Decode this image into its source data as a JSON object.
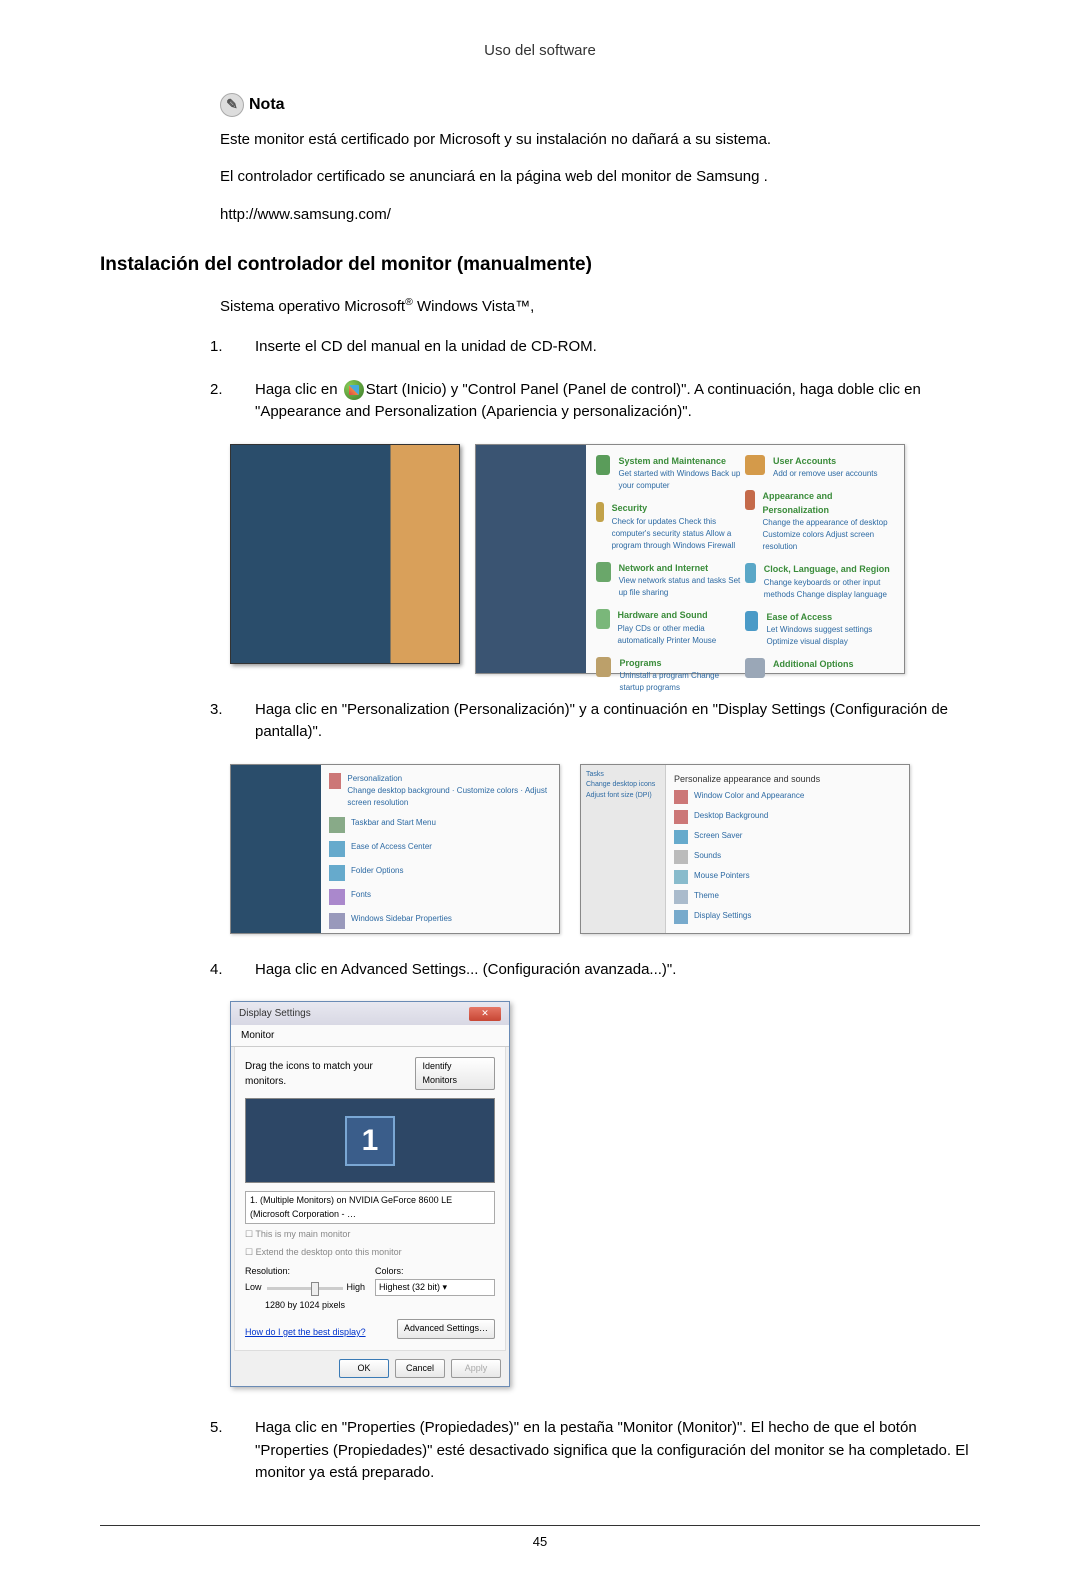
{
  "header": "Uso del software",
  "note": {
    "title": "Nota",
    "lines": [
      "Este monitor está certificado por Microsoft y su instalación no dañará a su sistema.",
      "El controlador certificado se anunciará en la página web del monitor de Samsung .",
      "http://www.samsung.com/"
    ]
  },
  "section_heading": "Instalación del controlador del monitor (manualmente)",
  "os_text_pre": "Sistema operativo Microsoft",
  "os_text_mid": " Windows Vista",
  "os_text_post": ",",
  "steps": {
    "s1": {
      "num": "1.",
      "text": "Inserte el CD del manual en la unidad de CD-ROM."
    },
    "s2": {
      "num": "2.",
      "pre": "Haga clic en ",
      "mid": "Start (Inicio) y \"Control Panel (Panel de control)\". A continuación, haga doble clic en \"Appearance and Personalization (Apariencia y personalización)\"."
    },
    "s3": {
      "num": "3.",
      "text": "Haga clic en \"Personalization (Personalización)\" y a continuación en \"Display Settings (Configuración de pantalla)\"."
    },
    "s4": {
      "num": "4.",
      "text": "Haga clic en Advanced Settings... (Configuración avanzada...)\"."
    },
    "s5": {
      "num": "5.",
      "text": "Haga clic en \"Properties (Propiedades)\" en la pestaña \"Monitor (Monitor)\". El hecho de que el botón \"Properties (Propiedades)\" esté desactivado significa que la configuración del monitor se ha completado. El monitor ya está preparado."
    }
  },
  "control_panel": {
    "items_left": [
      {
        "title": "System and Maintenance",
        "sub": "Get started with Windows\nBack up your computer"
      },
      {
        "title": "Security",
        "sub": "Check for updates\nCheck this computer's security status\nAllow a program through Windows Firewall"
      },
      {
        "title": "Network and Internet",
        "sub": "View network status and tasks\nSet up file sharing"
      },
      {
        "title": "Hardware and Sound",
        "sub": "Play CDs or other media automatically\nPrinter\nMouse"
      },
      {
        "title": "Programs",
        "sub": "Uninstall a program\nChange startup programs"
      }
    ],
    "items_right": [
      {
        "title": "User Accounts",
        "sub": "Add or remove user accounts"
      },
      {
        "title": "Appearance and Personalization",
        "sub": "Change the appearance of desktop\nCustomize colors\nAdjust screen resolution"
      },
      {
        "title": "Clock, Language, and Region",
        "sub": "Change keyboards or other input methods\nChange display language"
      },
      {
        "title": "Ease of Access",
        "sub": "Let Windows suggest settings\nOptimize visual display"
      },
      {
        "title": "Additional Options",
        "sub": ""
      }
    ]
  },
  "display_settings": {
    "title": "Display Settings",
    "tab": "Monitor",
    "hint": "Drag the icons to match your monitors.",
    "identify": "Identify Monitors",
    "monitor_num": "1",
    "dropdown": "1. (Multiple Monitors) on NVIDIA GeForce 8600 LE (Microsoft Corporation - …",
    "check1": "This is my main monitor",
    "check2": "Extend the desktop onto this monitor",
    "res_label": "Resolution:",
    "low": "Low",
    "high": "High",
    "res_value": "1280 by 1024 pixels",
    "colors_label": "Colors:",
    "colors_value": "Highest (32 bit)",
    "help_link": "How do I get the best display?",
    "adv": "Advanced Settings…",
    "ok": "OK",
    "cancel": "Cancel",
    "apply": "Apply"
  },
  "page_number": "45"
}
